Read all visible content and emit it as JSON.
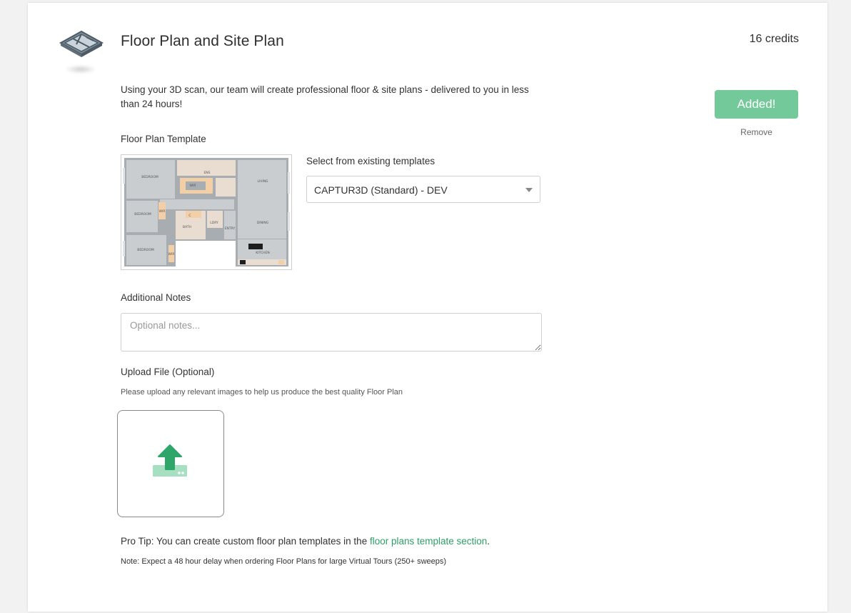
{
  "product": {
    "icon": "floor-plan-icon",
    "title": "Floor Plan and Site Plan",
    "credits": "16 credits",
    "description": "Using your 3D scan, our team will create professional floor & site plans - delivered to you in less than 24 hours!",
    "added_label": "Added!",
    "remove_label": "Remove"
  },
  "template": {
    "section_label": "Floor Plan Template",
    "preview_alt": "floor-plan-template-preview",
    "select_label": "Select from existing templates",
    "selected_value": "CAPTUR3D (Standard) - DEV",
    "room_labels": [
      "BEDROOM",
      "BEDROOM",
      "BEDROOM",
      "LIVING",
      "DINING",
      "KITCHEN",
      "BATH",
      "ENTRY",
      "ENS",
      "WIR",
      "LDRY",
      "WIR",
      "WIR",
      "C"
    ]
  },
  "notes": {
    "label": "Additional Notes",
    "placeholder": "Optional notes..."
  },
  "upload": {
    "label": "Upload File (Optional)",
    "help": "Please upload any relevant images to help us produce the best quality Floor Plan",
    "icon": "upload-icon"
  },
  "footer": {
    "pro_tip_prefix": "Pro Tip: You can create custom floor plan templates in the ",
    "pro_tip_link": "floor plans template section",
    "pro_tip_suffix": ".",
    "note": "Note: Expect a 48 hour delay when ordering Floor Plans for large Virtual Tours (250+ sweeps)"
  },
  "colors": {
    "accent_green": "#73c99a",
    "link_green": "#2e9e66",
    "upload_green": "#2ea66a"
  }
}
